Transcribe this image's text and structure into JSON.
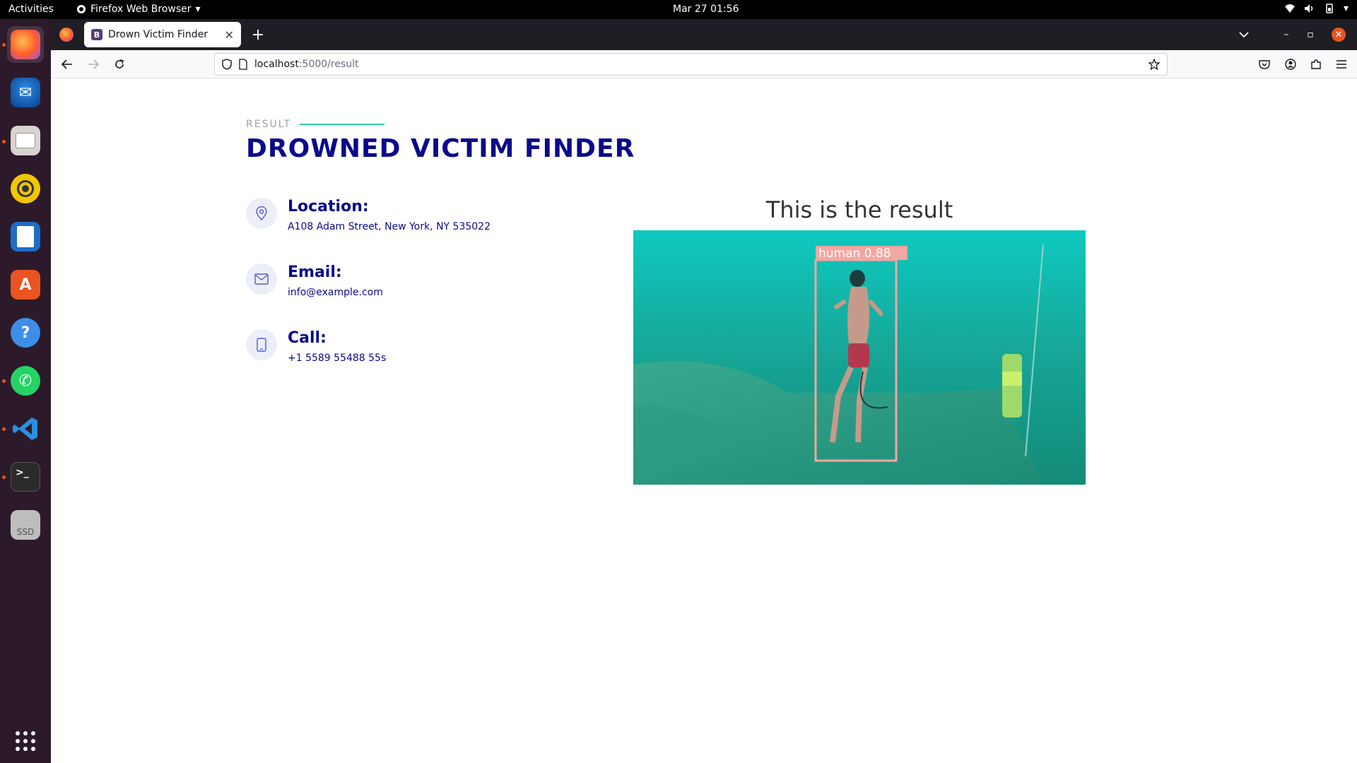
{
  "topbar": {
    "activities": "Activities",
    "app_name": "Firefox Web Browser",
    "clock": "Mar 27  01:56"
  },
  "dock": {
    "apps": [
      {
        "name": "Firefox",
        "icon": "firefox-icon"
      },
      {
        "name": "Thunderbird",
        "icon": "thunderbird-icon"
      },
      {
        "name": "Files",
        "icon": "files-icon"
      },
      {
        "name": "Rhythmbox",
        "icon": "rhythmbox-icon"
      },
      {
        "name": "LibreOffice Writer",
        "icon": "writer-icon"
      },
      {
        "name": "Ubuntu Software",
        "icon": "software-icon"
      },
      {
        "name": "Help",
        "icon": "help-icon"
      },
      {
        "name": "WhatsApp",
        "icon": "whatsapp-icon"
      },
      {
        "name": "Visual Studio Code",
        "icon": "vscode-icon"
      },
      {
        "name": "Terminal",
        "icon": "terminal-icon"
      },
      {
        "name": "SSD",
        "icon": "drive-icon",
        "label": "SSD"
      }
    ]
  },
  "browser": {
    "tab_title": "Drown Victim Finder",
    "tab_favicon": "B",
    "url_host": "localhost",
    "url_path": ":5000/result"
  },
  "page": {
    "section_label": "RESULT",
    "title": "DROWNED VICTIM FINDER",
    "info": [
      {
        "title": "Location:",
        "value": "A108 Adam Street, New York, NY 535022",
        "icon": "map-pin-icon"
      },
      {
        "title": "Email:",
        "value": "info@example.com",
        "icon": "envelope-icon"
      },
      {
        "title": "Call:",
        "value": "+1 5589 55488 55s",
        "icon": "phone-icon"
      }
    ],
    "result_heading": "This is the result",
    "detection_label": "human  0.88"
  },
  "colors": {
    "accent": "#2fd0a3",
    "title": "#0a0a8a",
    "detection_box": "#f4a6a0"
  }
}
